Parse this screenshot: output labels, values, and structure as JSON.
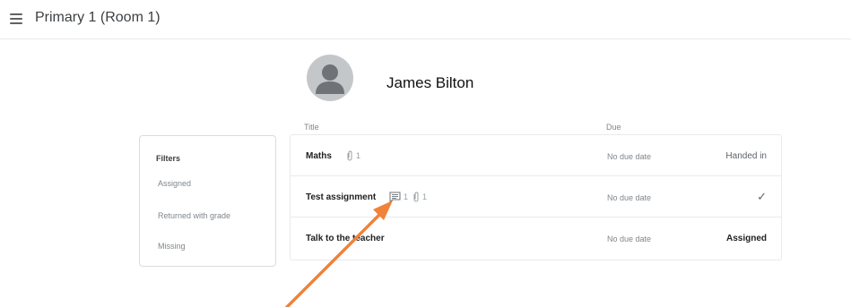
{
  "header": {
    "title": "Primary 1 (Room 1)",
    "menu_icon": "hamburger-menu-icon"
  },
  "student": {
    "name": "James Bilton",
    "avatar_icon": "person-avatar-icon"
  },
  "columns": {
    "title": "Title",
    "due": "Due"
  },
  "filters": {
    "heading": "Filters",
    "items": [
      "Assigned",
      "Returned with grade",
      "Missing"
    ]
  },
  "assignments": [
    {
      "title": "Maths",
      "comments": null,
      "attachments": "1",
      "due": "No due date",
      "status": "Handed in"
    },
    {
      "title": "Test assignment",
      "comments": "1",
      "attachments": "1",
      "due": "No due date",
      "status": "✓"
    },
    {
      "title": "Talk to the teacher",
      "comments": null,
      "attachments": null,
      "due": "No due date",
      "status": "Assigned"
    }
  ],
  "colors": {
    "annotation_arrow": "#f0823a",
    "border": "#dadce0",
    "muted_text": "#80868b"
  }
}
